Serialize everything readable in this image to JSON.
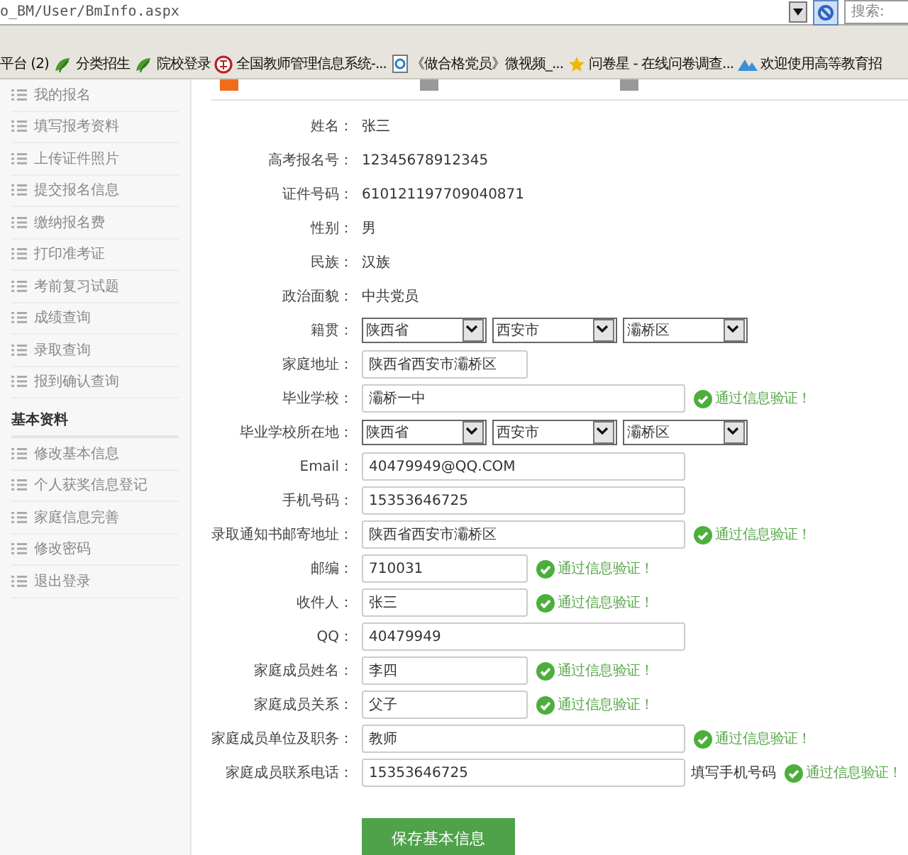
{
  "address_bar": {
    "url": "o_BM/User/BmInfo.aspx",
    "search_placeholder": "搜索:"
  },
  "bookmarks": [
    {
      "label": "平台 (2)"
    },
    {
      "label": "分类招生"
    },
    {
      "label": "院校登录"
    },
    {
      "label": "全国教师管理信息系统-..."
    },
    {
      "label": "《做合格党员》微视频_..."
    },
    {
      "label": "问卷星 - 在线问卷调查..."
    },
    {
      "label": "欢迎使用高等教育招"
    }
  ],
  "sidebar": {
    "sections": [
      {
        "items": [
          {
            "label": "我的报名"
          },
          {
            "label": "填写报考资料"
          },
          {
            "label": "上传证件照片"
          },
          {
            "label": "提交报名信息"
          },
          {
            "label": "缴纳报名费"
          },
          {
            "label": "打印准考证"
          },
          {
            "label": "考前复习试题"
          },
          {
            "label": "成绩查询"
          },
          {
            "label": "录取查询"
          },
          {
            "label": "报到确认查询"
          }
        ]
      },
      {
        "heading": "基本资料",
        "items": [
          {
            "label": "修改基本信息"
          },
          {
            "label": "个人获奖信息登记"
          },
          {
            "label": "家庭信息完善"
          },
          {
            "label": "修改密码"
          },
          {
            "label": "退出登录"
          }
        ]
      }
    ]
  },
  "steps": [
    {
      "selected": true
    },
    {
      "selected": false
    },
    {
      "selected": false
    }
  ],
  "fields": [
    {
      "kind": "text",
      "label": "姓名：",
      "value": "张三"
    },
    {
      "kind": "text",
      "label": "高考报名号：",
      "value": "12345678912345"
    },
    {
      "kind": "text",
      "label": "证件号码：",
      "value": "610121197709040871"
    },
    {
      "kind": "text",
      "label": "性别：",
      "value": "男"
    },
    {
      "kind": "text",
      "label": "民族：",
      "value": "汉族"
    },
    {
      "kind": "text",
      "label": "政治面貌：",
      "value": "中共党员"
    },
    {
      "kind": "select",
      "label": "籍贯：",
      "options": [
        "陕西省",
        "西安市",
        "灞桥区"
      ]
    },
    {
      "kind": "shortinput",
      "label": "家庭地址：",
      "value": "陕西省西安市灞桥区"
    },
    {
      "kind": "input",
      "label": "毕业学校：",
      "value": "灞桥一中",
      "verified": "通过信息验证！"
    },
    {
      "kind": "select",
      "label": "毕业学校所在地：",
      "options": [
        "陕西省",
        "西安市",
        "灞桥区"
      ]
    },
    {
      "kind": "input",
      "label": "Email：",
      "value": "40479949@QQ.COM"
    },
    {
      "kind": "input",
      "label": "手机号码：",
      "value": "15353646725"
    },
    {
      "kind": "input",
      "label": "录取通知书邮寄地址：",
      "value": "陕西省西安市灞桥区",
      "verified": "通过信息验证！"
    },
    {
      "kind": "shortinput",
      "label": "邮编：",
      "value": "710031",
      "verified": "通过信息验证！"
    },
    {
      "kind": "shortinput",
      "label": "收件人：",
      "value": "张三",
      "verified": "通过信息验证！"
    },
    {
      "kind": "input",
      "label": "QQ：",
      "value": "40479949"
    },
    {
      "kind": "shortinput",
      "label": "家庭成员姓名：",
      "value": "李四",
      "verified": "通过信息验证！"
    },
    {
      "kind": "shortinput",
      "label": "家庭成员关系：",
      "value": "父子",
      "verified": "通过信息验证！"
    },
    {
      "kind": "input",
      "label": "家庭成员单位及职务：",
      "value": "教师",
      "verified": "通过信息验证！"
    },
    {
      "kind": "input",
      "label": "家庭成员联系电话：",
      "value": "15353646725",
      "hint": "填写手机号码",
      "verified": "通过信息验证！"
    }
  ],
  "save_button": "保存基本信息"
}
